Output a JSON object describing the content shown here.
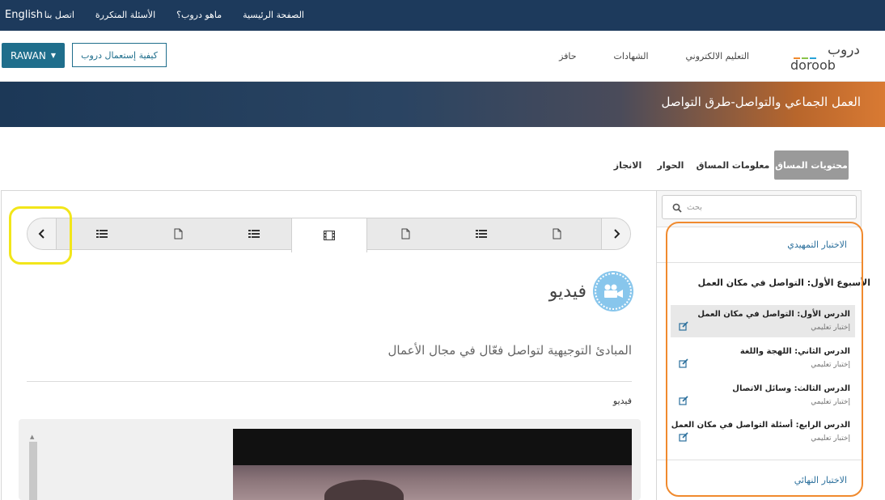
{
  "topbar": {
    "language": "English",
    "links": [
      "الصفحة الرئيسية",
      "ماهو دروب؟",
      "الأسئلة المتكررة",
      "اتصل بنا"
    ]
  },
  "header": {
    "logo_ar": "دروب",
    "logo_en": "doroob",
    "nav": [
      "التعليم الالكتروني",
      "الشهادات",
      "حافز"
    ],
    "how_to": "كيفية إستعمال دروب",
    "user": "RAWAN"
  },
  "banner": {
    "title": "العمل الجماعي والتواصل-طرق التواصل"
  },
  "tabs": [
    {
      "label": "محتويات المساق",
      "active": true
    },
    {
      "label": "معلومات المساق",
      "active": false
    },
    {
      "label": "الحوار",
      "active": false
    },
    {
      "label": "الانجاز",
      "active": false
    }
  ],
  "sidebar": {
    "search_placeholder": "بحث",
    "intro_test": "الاختبار التمهيدي",
    "week_title": "الأسبوع الأول: التواصل في مكان العمل",
    "lessons": [
      {
        "name": "الدرس الأول: التواصل في مكان العمل",
        "sub": "إختبار تعليمي",
        "active": true
      },
      {
        "name": "الدرس الثاني: اللهجة واللغة",
        "sub": "إختبار تعليمي",
        "active": false
      },
      {
        "name": "الدرس الثالث: وسائل الاتصال",
        "sub": "إختبار تعليمي",
        "active": false
      },
      {
        "name": "الدرس الرابع: أسئلة التواصل في مكان العمل",
        "sub": "إختبار تعليمي",
        "active": false
      }
    ],
    "final_test": "الاختبار النهائي"
  },
  "carousel": {
    "items": [
      "list-icon",
      "page-icon",
      "list-icon",
      "film-icon",
      "page-icon",
      "list-icon",
      "page-icon"
    ],
    "active_index": 3
  },
  "main": {
    "heading": "فيديو",
    "description": "المبادئ التوجيهية لتواصل فعّال في مجال الأعمال",
    "video_caption": "فيديو"
  },
  "colors": {
    "topbar": "#1d3a5c",
    "accent": "#1f6e8c",
    "highlight_yellow": "#f2e61a",
    "highlight_orange": "#f08a2e"
  }
}
